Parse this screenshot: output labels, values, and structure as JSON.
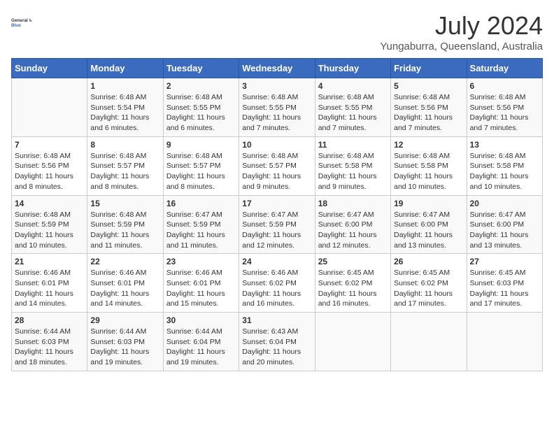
{
  "header": {
    "logo_line1": "General",
    "logo_line2": "Blue",
    "month": "July 2024",
    "location": "Yungaburra, Queensland, Australia"
  },
  "weekdays": [
    "Sunday",
    "Monday",
    "Tuesday",
    "Wednesday",
    "Thursday",
    "Friday",
    "Saturday"
  ],
  "weeks": [
    [
      {
        "day": "",
        "sunrise": "",
        "sunset": "",
        "daylight": ""
      },
      {
        "day": "1",
        "sunrise": "Sunrise: 6:48 AM",
        "sunset": "Sunset: 5:54 PM",
        "daylight": "Daylight: 11 hours and 6 minutes."
      },
      {
        "day": "2",
        "sunrise": "Sunrise: 6:48 AM",
        "sunset": "Sunset: 5:55 PM",
        "daylight": "Daylight: 11 hours and 6 minutes."
      },
      {
        "day": "3",
        "sunrise": "Sunrise: 6:48 AM",
        "sunset": "Sunset: 5:55 PM",
        "daylight": "Daylight: 11 hours and 7 minutes."
      },
      {
        "day": "4",
        "sunrise": "Sunrise: 6:48 AM",
        "sunset": "Sunset: 5:55 PM",
        "daylight": "Daylight: 11 hours and 7 minutes."
      },
      {
        "day": "5",
        "sunrise": "Sunrise: 6:48 AM",
        "sunset": "Sunset: 5:56 PM",
        "daylight": "Daylight: 11 hours and 7 minutes."
      },
      {
        "day": "6",
        "sunrise": "Sunrise: 6:48 AM",
        "sunset": "Sunset: 5:56 PM",
        "daylight": "Daylight: 11 hours and 7 minutes."
      }
    ],
    [
      {
        "day": "7",
        "sunrise": "Sunrise: 6:48 AM",
        "sunset": "Sunset: 5:56 PM",
        "daylight": "Daylight: 11 hours and 8 minutes."
      },
      {
        "day": "8",
        "sunrise": "Sunrise: 6:48 AM",
        "sunset": "Sunset: 5:57 PM",
        "daylight": "Daylight: 11 hours and 8 minutes."
      },
      {
        "day": "9",
        "sunrise": "Sunrise: 6:48 AM",
        "sunset": "Sunset: 5:57 PM",
        "daylight": "Daylight: 11 hours and 8 minutes."
      },
      {
        "day": "10",
        "sunrise": "Sunrise: 6:48 AM",
        "sunset": "Sunset: 5:57 PM",
        "daylight": "Daylight: 11 hours and 9 minutes."
      },
      {
        "day": "11",
        "sunrise": "Sunrise: 6:48 AM",
        "sunset": "Sunset: 5:58 PM",
        "daylight": "Daylight: 11 hours and 9 minutes."
      },
      {
        "day": "12",
        "sunrise": "Sunrise: 6:48 AM",
        "sunset": "Sunset: 5:58 PM",
        "daylight": "Daylight: 11 hours and 10 minutes."
      },
      {
        "day": "13",
        "sunrise": "Sunrise: 6:48 AM",
        "sunset": "Sunset: 5:58 PM",
        "daylight": "Daylight: 11 hours and 10 minutes."
      }
    ],
    [
      {
        "day": "14",
        "sunrise": "Sunrise: 6:48 AM",
        "sunset": "Sunset: 5:59 PM",
        "daylight": "Daylight: 11 hours and 10 minutes."
      },
      {
        "day": "15",
        "sunrise": "Sunrise: 6:48 AM",
        "sunset": "Sunset: 5:59 PM",
        "daylight": "Daylight: 11 hours and 11 minutes."
      },
      {
        "day": "16",
        "sunrise": "Sunrise: 6:47 AM",
        "sunset": "Sunset: 5:59 PM",
        "daylight": "Daylight: 11 hours and 11 minutes."
      },
      {
        "day": "17",
        "sunrise": "Sunrise: 6:47 AM",
        "sunset": "Sunset: 5:59 PM",
        "daylight": "Daylight: 11 hours and 12 minutes."
      },
      {
        "day": "18",
        "sunrise": "Sunrise: 6:47 AM",
        "sunset": "Sunset: 6:00 PM",
        "daylight": "Daylight: 11 hours and 12 minutes."
      },
      {
        "day": "19",
        "sunrise": "Sunrise: 6:47 AM",
        "sunset": "Sunset: 6:00 PM",
        "daylight": "Daylight: 11 hours and 13 minutes."
      },
      {
        "day": "20",
        "sunrise": "Sunrise: 6:47 AM",
        "sunset": "Sunset: 6:00 PM",
        "daylight": "Daylight: 11 hours and 13 minutes."
      }
    ],
    [
      {
        "day": "21",
        "sunrise": "Sunrise: 6:46 AM",
        "sunset": "Sunset: 6:01 PM",
        "daylight": "Daylight: 11 hours and 14 minutes."
      },
      {
        "day": "22",
        "sunrise": "Sunrise: 6:46 AM",
        "sunset": "Sunset: 6:01 PM",
        "daylight": "Daylight: 11 hours and 14 minutes."
      },
      {
        "day": "23",
        "sunrise": "Sunrise: 6:46 AM",
        "sunset": "Sunset: 6:01 PM",
        "daylight": "Daylight: 11 hours and 15 minutes."
      },
      {
        "day": "24",
        "sunrise": "Sunrise: 6:46 AM",
        "sunset": "Sunset: 6:02 PM",
        "daylight": "Daylight: 11 hours and 16 minutes."
      },
      {
        "day": "25",
        "sunrise": "Sunrise: 6:45 AM",
        "sunset": "Sunset: 6:02 PM",
        "daylight": "Daylight: 11 hours and 16 minutes."
      },
      {
        "day": "26",
        "sunrise": "Sunrise: 6:45 AM",
        "sunset": "Sunset: 6:02 PM",
        "daylight": "Daylight: 11 hours and 17 minutes."
      },
      {
        "day": "27",
        "sunrise": "Sunrise: 6:45 AM",
        "sunset": "Sunset: 6:03 PM",
        "daylight": "Daylight: 11 hours and 17 minutes."
      }
    ],
    [
      {
        "day": "28",
        "sunrise": "Sunrise: 6:44 AM",
        "sunset": "Sunset: 6:03 PM",
        "daylight": "Daylight: 11 hours and 18 minutes."
      },
      {
        "day": "29",
        "sunrise": "Sunrise: 6:44 AM",
        "sunset": "Sunset: 6:03 PM",
        "daylight": "Daylight: 11 hours and 19 minutes."
      },
      {
        "day": "30",
        "sunrise": "Sunrise: 6:44 AM",
        "sunset": "Sunset: 6:04 PM",
        "daylight": "Daylight: 11 hours and 19 minutes."
      },
      {
        "day": "31",
        "sunrise": "Sunrise: 6:43 AM",
        "sunset": "Sunset: 6:04 PM",
        "daylight": "Daylight: 11 hours and 20 minutes."
      },
      {
        "day": "",
        "sunrise": "",
        "sunset": "",
        "daylight": ""
      },
      {
        "day": "",
        "sunrise": "",
        "sunset": "",
        "daylight": ""
      },
      {
        "day": "",
        "sunrise": "",
        "sunset": "",
        "daylight": ""
      }
    ]
  ]
}
